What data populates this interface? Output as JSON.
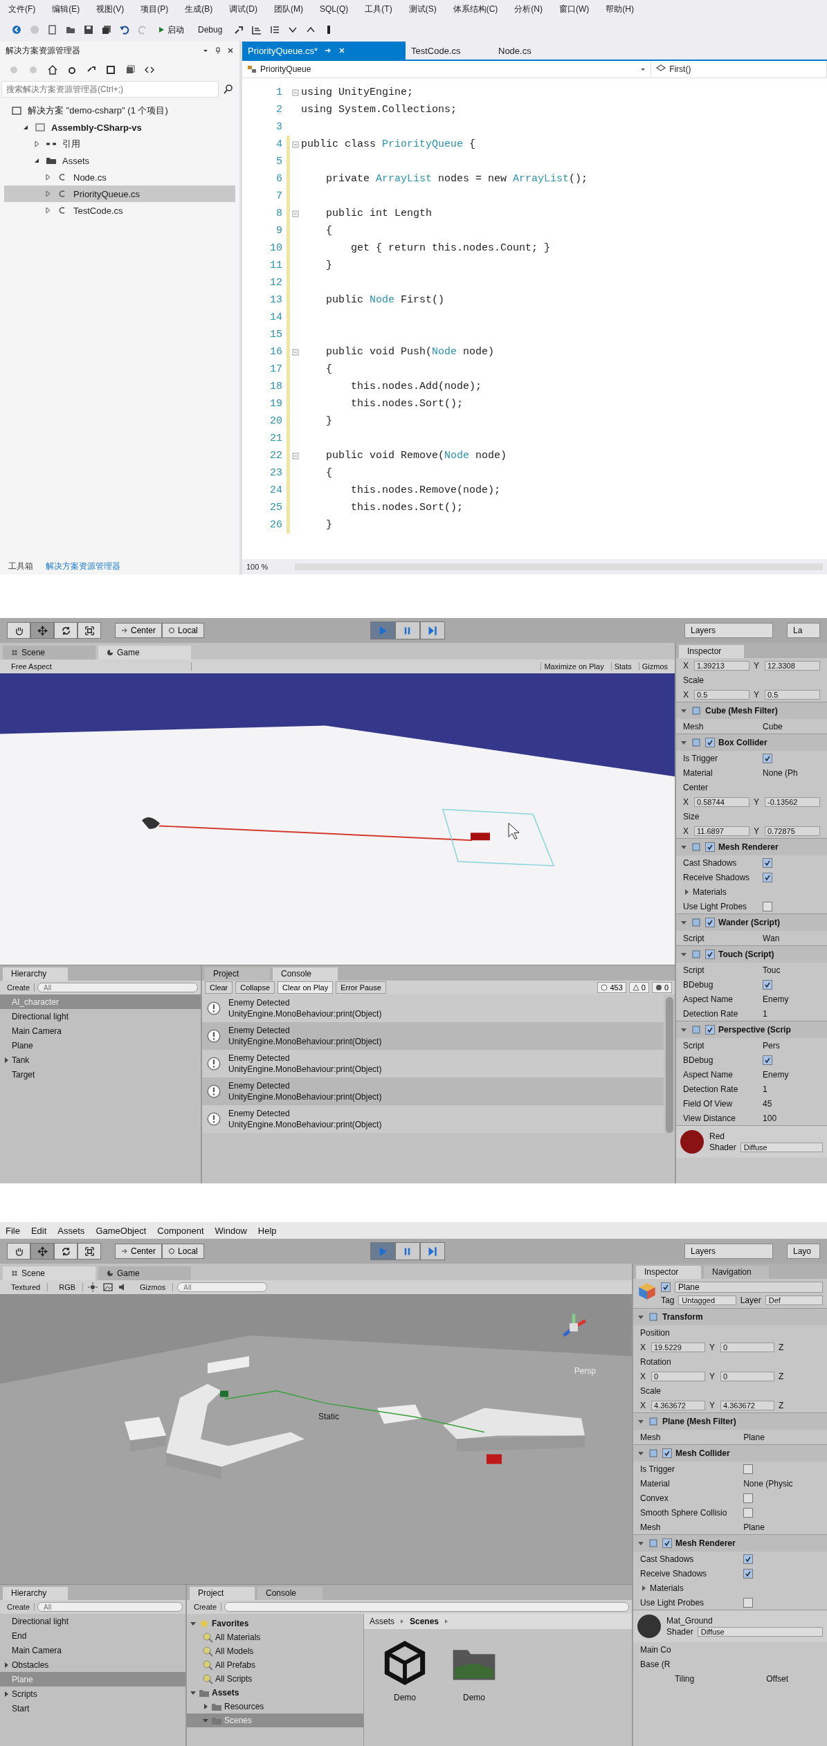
{
  "vs": {
    "menu": [
      "文件(F)",
      "编辑(E)",
      "视图(V)",
      "项目(P)",
      "生成(B)",
      "调试(D)",
      "团队(M)",
      "SQL(Q)",
      "工具(T)",
      "测试(S)",
      "体系结构(C)",
      "分析(N)",
      "窗口(W)",
      "帮助(H)"
    ],
    "toolbar": {
      "start": "启动",
      "configuration": "Debug"
    },
    "explorer": {
      "title": "解决方案资源管理器",
      "search_placeholder": "搜索解决方案资源管理器(Ctrl+;)",
      "tree": [
        {
          "label": "解决方案 \"demo-csharp\" (1 个项目)",
          "kind": "solution",
          "selected": false,
          "children": [
            {
              "label": "Assembly-CSharp-vs",
              "kind": "project",
              "expanded": true,
              "selected": false,
              "children": [
                {
                  "label": "引用",
                  "kind": "references",
                  "expanded": false,
                  "selected": false
                },
                {
                  "label": "Assets",
                  "kind": "folder",
                  "expanded": true,
                  "selected": false,
                  "children": [
                    {
                      "label": "Node.cs",
                      "kind": "file",
                      "expanded": false,
                      "selected": false
                    },
                    {
                      "label": "PriorityQueue.cs",
                      "kind": "file",
                      "expanded": false,
                      "selected": true
                    },
                    {
                      "label": "TestCode.cs",
                      "kind": "file",
                      "expanded": false,
                      "selected": false
                    }
                  ]
                }
              ]
            }
          ]
        }
      ],
      "bottom_tabs": [
        {
          "label": "工具箱",
          "selected": false
        },
        {
          "label": "解决方案资源管理器",
          "selected": true
        }
      ]
    },
    "editor": {
      "tabs": [
        {
          "label": "PriorityQueue.cs*",
          "selected": true
        },
        {
          "label": "TestCode.cs",
          "selected": false
        },
        {
          "label": "Node.cs",
          "selected": false
        }
      ],
      "class_nav": "PriorityQueue",
      "member_nav": "First()",
      "zoom": "100 %",
      "lines": [
        {
          "number": "1",
          "fold": true,
          "changed": false,
          "segments": [
            {
              "text": "using UnityEngine;",
              "kind": "code"
            }
          ]
        },
        {
          "number": "2",
          "fold": false,
          "changed": false,
          "segments": [
            {
              "text": "using System.Collections;",
              "kind": "code"
            }
          ]
        },
        {
          "number": "3",
          "fold": false,
          "changed": false
        },
        {
          "number": "4",
          "fold": true,
          "changed": true,
          "segments": [
            {
              "text": "public class ",
              "kind": "code"
            },
            {
              "text": "PriorityQueue",
              "kind": "type"
            },
            {
              "text": " {",
              "kind": "code"
            }
          ]
        },
        {
          "number": "5",
          "fold": false,
          "changed": true
        },
        {
          "number": "6",
          "fold": false,
          "changed": true,
          "segments": [
            {
              "text": "    private ",
              "kind": "code"
            },
            {
              "text": "ArrayList",
              "kind": "type"
            },
            {
              "text": " nodes = new ",
              "kind": "code"
            },
            {
              "text": "ArrayList",
              "kind": "type"
            },
            {
              "text": "();",
              "kind": "code"
            }
          ]
        },
        {
          "number": "7",
          "fold": false,
          "changed": true
        },
        {
          "number": "8",
          "fold": true,
          "changed": true,
          "segments": [
            {
              "text": "    public int Length",
              "kind": "code"
            }
          ]
        },
        {
          "number": "9",
          "fold": false,
          "changed": true,
          "segments": [
            {
              "text": "    {",
              "kind": "code"
            }
          ]
        },
        {
          "number": "10",
          "fold": false,
          "changed": true,
          "segments": [
            {
              "text": "        get { return this.nodes.Count; }",
              "kind": "code"
            }
          ]
        },
        {
          "number": "11",
          "fold": false,
          "changed": true,
          "segments": [
            {
              "text": "    }",
              "kind": "code"
            }
          ]
        },
        {
          "number": "12",
          "fold": false,
          "changed": true
        },
        {
          "number": "13",
          "fold": false,
          "changed": true,
          "segments": [
            {
              "text": "    public ",
              "kind": "code"
            },
            {
              "text": "Node",
              "kind": "type"
            },
            {
              "text": " First()",
              "kind": "code"
            }
          ]
        },
        {
          "number": "14",
          "fold": false,
          "changed": true
        },
        {
          "number": "15",
          "fold": false,
          "changed": true
        },
        {
          "number": "16",
          "fold": true,
          "changed": true,
          "segments": [
            {
              "text": "    public void Push(",
              "kind": "code"
            },
            {
              "text": "Node",
              "kind": "type"
            },
            {
              "text": " node)",
              "kind": "code"
            }
          ]
        },
        {
          "number": "17",
          "fold": false,
          "changed": true,
          "segments": [
            {
              "text": "    {",
              "kind": "code"
            }
          ]
        },
        {
          "number": "18",
          "fold": false,
          "changed": true,
          "segments": [
            {
              "text": "        this.nodes.Add(node);",
              "kind": "code"
            }
          ]
        },
        {
          "number": "19",
          "fold": false,
          "changed": true,
          "segments": [
            {
              "text": "        this.nodes.Sort();",
              "kind": "code"
            }
          ]
        },
        {
          "number": "20",
          "fold": false,
          "changed": true,
          "segments": [
            {
              "text": "    }",
              "kind": "code"
            }
          ]
        },
        {
          "number": "21",
          "fold": false,
          "changed": true
        },
        {
          "number": "22",
          "fold": true,
          "changed": true,
          "segments": [
            {
              "text": "    public void Remove(",
              "kind": "code"
            },
            {
              "text": "Node",
              "kind": "type"
            },
            {
              "text": " node)",
              "kind": "code"
            }
          ]
        },
        {
          "number": "23",
          "fold": false,
          "changed": true,
          "segments": [
            {
              "text": "    {",
              "kind": "code"
            }
          ]
        },
        {
          "number": "24",
          "fold": false,
          "changed": true,
          "segments": [
            {
              "text": "        this.nodes.Remove(node);",
              "kind": "code"
            }
          ]
        },
        {
          "number": "25",
          "fold": false,
          "changed": true,
          "segments": [
            {
              "text": "        this.nodes.Sort();",
              "kind": "code"
            }
          ]
        },
        {
          "number": "26",
          "fold": false,
          "changed": true,
          "segments": [
            {
              "text": "    }",
              "kind": "code"
            }
          ]
        }
      ]
    }
  },
  "game_editor": {
    "toolbar": {
      "tools": [
        {
          "selected": false
        },
        {
          "selected": true
        },
        {
          "selected": false
        },
        {
          "selected": false
        }
      ],
      "pivot": "Center",
      "space": "Local",
      "play_controls": [
        {
          "on": true
        },
        {
          "on": false
        },
        {
          "on": false
        }
      ],
      "layers": "Layers",
      "layout": "La"
    },
    "view_tabs": [
      {
        "label": "Scene",
        "selected": false
      },
      {
        "label": "Game",
        "selected": true
      }
    ],
    "view_bar": {
      "aspect": "Free Aspect",
      "buttons": [
        "Maximize on Play",
        "Stats",
        "Gizmos"
      ]
    },
    "inspector": {
      "tabs": [
        {
          "label": "Inspector",
          "selected": true
        }
      ],
      "items": [
        {
          "kind": "vector",
          "fields": [
            {
              "axis": "X",
              "value": "1.39213"
            },
            {
              "axis": "Y",
              "value": "12.3308"
            }
          ]
        },
        {
          "kind": "caption",
          "label": "Scale"
        },
        {
          "kind": "vector",
          "fields": [
            {
              "axis": "X",
              "value": "0.5"
            },
            {
              "axis": "Y",
              "value": "0.5"
            }
          ]
        },
        {
          "kind": "header",
          "title": "Cube (Mesh Filter)",
          "expanded": true
        },
        {
          "kind": "value",
          "label": "Mesh",
          "value": "Cube"
        },
        {
          "kind": "header",
          "title": "Box Collider",
          "expanded": true,
          "enabled": true
        },
        {
          "kind": "check",
          "label": "Is Trigger",
          "checked": true
        },
        {
          "kind": "value",
          "label": "Material",
          "value": "None (Ph"
        },
        {
          "kind": "caption",
          "label": "Center"
        },
        {
          "kind": "vector",
          "fields": [
            {
              "axis": "X",
              "value": "0.58744"
            },
            {
              "axis": "Y",
              "value": "-0.13562"
            }
          ]
        },
        {
          "kind": "caption",
          "label": "Size"
        },
        {
          "kind": "vector",
          "fields": [
            {
              "axis": "X",
              "value": "11.6897"
            },
            {
              "axis": "Y",
              "value": "0.72875"
            }
          ]
        },
        {
          "kind": "header",
          "title": "Mesh Renderer",
          "expanded": true,
          "enabled": true
        },
        {
          "kind": "check",
          "label": "Cast Shadows",
          "checked": true
        },
        {
          "kind": "check",
          "label": "Receive Shadows",
          "checked": true
        },
        {
          "kind": "foldout",
          "label": "Materials",
          "expanded": false
        },
        {
          "kind": "check",
          "label": "Use Light Probes",
          "checked": false
        },
        {
          "kind": "header",
          "title": "Wander (Script)",
          "expanded": true,
          "enabled": true
        },
        {
          "kind": "value",
          "label": "Script",
          "value": "Wan"
        },
        {
          "kind": "header",
          "title": "Touch (Script)",
          "expanded": true,
          "enabled": true
        },
        {
          "kind": "value",
          "label": "Script",
          "value": "Touc"
        },
        {
          "kind": "check",
          "label": "BDebug",
          "checked": true
        },
        {
          "kind": "value",
          "label": "Aspect Name",
          "value": "Enemy"
        },
        {
          "kind": "value",
          "label": "Detection Rate",
          "value": "1"
        },
        {
          "kind": "header",
          "title": "Perspective (Scrip",
          "expanded": true,
          "enabled": true
        },
        {
          "kind": "value",
          "label": "Script",
          "value": "Pers"
        },
        {
          "kind": "check",
          "label": "BDebug",
          "checked": true
        },
        {
          "kind": "value",
          "label": "Aspect Name",
          "value": "Enemy"
        },
        {
          "kind": "value",
          "label": "Detection Rate",
          "value": "1"
        },
        {
          "kind": "value",
          "label": "Field Of View",
          "value": "45"
        },
        {
          "kind": "value",
          "label": "View Distance",
          "value": "100"
        },
        {
          "kind": "material",
          "name": "Red",
          "shader_label": "Shader",
          "shader": "Diffuse",
          "color": "#8a1212"
        }
      ]
    },
    "hierarchy": {
      "title": "Hierarchy",
      "create": "Create",
      "search_placeholder": "All",
      "items": [
        {
          "label": "AI_character",
          "selected": true
        },
        {
          "label": "Directional light",
          "selected": false
        },
        {
          "label": "Main Camera",
          "selected": false
        },
        {
          "label": "Plane",
          "selected": false
        },
        {
          "label": "Tank",
          "selected": false,
          "expanded": false
        },
        {
          "label": "Target",
          "selected": false
        }
      ]
    },
    "console": {
      "tabs": [
        {
          "label": "Project",
          "selected": false
        },
        {
          "label": "Console",
          "selected": true
        }
      ],
      "buttons": [
        {
          "label": "Clear",
          "on": false
        },
        {
          "label": "Collapse",
          "on": false
        },
        {
          "label": "Clear on Play",
          "on": true
        },
        {
          "label": "Error Pause",
          "on": false
        }
      ],
      "counts": {
        "logs": "453",
        "warnings": "0",
        "errors": "0"
      },
      "entries": [
        {
          "message": "Enemy Detected",
          "source": "UnityEngine.MonoBehaviour:print(Object)"
        },
        {
          "message": "Enemy Detected",
          "source": "UnityEngine.MonoBehaviour:print(Object)"
        },
        {
          "message": "Enemy Detected",
          "source": "UnityEngine.MonoBehaviour:print(Object)"
        },
        {
          "message": "Enemy Detected",
          "source": "UnityEngine.MonoBehaviour:print(Object)"
        },
        {
          "message": "Enemy Detected",
          "source": "UnityEngine.MonoBehaviour:print(Object)"
        }
      ]
    }
  },
  "scene_editor": {
    "menu": [
      "File",
      "Edit",
      "Assets",
      "GameObject",
      "Component",
      "Window",
      "Help"
    ],
    "toolbar": {
      "tools": [
        {
          "selected": false
        },
        {
          "selected": true
        },
        {
          "selected": false
        },
        {
          "selected": false
        }
      ],
      "pivot": "Center",
      "space": "Local",
      "play_controls": [
        {
          "on": true
        },
        {
          "on": false
        },
        {
          "on": false
        }
      ],
      "layers": "Layers",
      "layout": "Layo"
    },
    "view_tabs": [
      {
        "label": "Scene",
        "selected": true
      },
      {
        "label": "Game",
        "selected": false
      }
    ],
    "view_bar": {
      "shading": "Textured",
      "mode": "RGB",
      "gizmos": "Gizmos",
      "search_placeholder": "All"
    },
    "projection_label": "Persp",
    "object_label": "Static",
    "inspector": {
      "tabs": [
        {
          "label": "Inspector",
          "selected": true
        },
        {
          "label": "Navigation",
          "selected": false
        }
      ],
      "items": [
        {
          "kind": "object",
          "enabled": true,
          "name": "Plane",
          "tag_label": "Tag",
          "tag": "Untagged",
          "layer_label": "Layer",
          "layer": "Def"
        },
        {
          "kind": "header",
          "title": "Transform",
          "expanded": true
        },
        {
          "kind": "caption",
          "label": "Position"
        },
        {
          "kind": "vector",
          "fields": [
            {
              "axis": "X",
              "value": "19.5229"
            },
            {
              "axis": "Y",
              "value": "0"
            },
            {
              "axis": "Z"
            }
          ]
        },
        {
          "kind": "caption",
          "label": "Rotation"
        },
        {
          "kind": "vector",
          "fields": [
            {
              "axis": "X",
              "value": "0"
            },
            {
              "axis": "Y",
              "value": "0"
            },
            {
              "axis": "Z"
            }
          ]
        },
        {
          "kind": "caption",
          "label": "Scale"
        },
        {
          "kind": "vector",
          "fields": [
            {
              "axis": "X",
              "value": "4.363672"
            },
            {
              "axis": "Y",
              "value": "4.363672"
            },
            {
              "axis": "Z"
            }
          ]
        },
        {
          "kind": "header",
          "title": "Plane (Mesh Filter)",
          "expanded": true
        },
        {
          "kind": "value",
          "label": "Mesh",
          "value": "Plane"
        },
        {
          "kind": "header",
          "title": "Mesh Collider",
          "expanded": true,
          "enabled": true
        },
        {
          "kind": "check",
          "label": "Is Trigger",
          "checked": false
        },
        {
          "kind": "value",
          "label": "Material",
          "value": "None (Physic"
        },
        {
          "kind": "check",
          "label": "Convex",
          "checked": false
        },
        {
          "kind": "check",
          "label": "Smooth Sphere Collisio",
          "checked": false
        },
        {
          "kind": "value",
          "label": "Mesh",
          "value": "Plane"
        },
        {
          "kind": "header",
          "title": "Mesh Renderer",
          "expanded": true,
          "enabled": true
        },
        {
          "kind": "check",
          "label": "Cast Shadows",
          "checked": true
        },
        {
          "kind": "check",
          "label": "Receive Shadows",
          "checked": true
        },
        {
          "kind": "foldout",
          "label": "Materials",
          "expanded": false
        },
        {
          "kind": "check",
          "label": "Use Light Probes",
          "checked": false
        },
        {
          "kind": "material",
          "name": "Mat_Ground",
          "shader_label": "Shader",
          "shader": "Diffuse",
          "color": "#333333"
        },
        {
          "kind": "caption",
          "label": "Main Co"
        },
        {
          "kind": "caption",
          "label": "Base (R"
        },
        {
          "kind": "pair",
          "left": "Tiling",
          "right": "Offset"
        }
      ]
    },
    "hierarchy": {
      "title": "Hierarchy",
      "create": "Create",
      "search_placeholder": "All",
      "items": [
        {
          "label": "Directional light",
          "selected": false
        },
        {
          "label": "End",
          "selected": false
        },
        {
          "label": "Main Camera",
          "selected": false
        },
        {
          "label": "Obstacles",
          "selected": false,
          "expanded": false
        },
        {
          "label": "Plane",
          "selected": true
        },
        {
          "label": "Scripts",
          "selected": false,
          "expanded": false
        },
        {
          "label": "Start",
          "selected": false
        }
      ]
    },
    "project": {
      "tabs": [
        {
          "label": "Project",
          "selected": true
        },
        {
          "label": "Console",
          "selected": false
        }
      ],
      "create": "Create",
      "tree": [
        {
          "label": "Favorites",
          "kind": "favorites",
          "expanded": true,
          "selected": false,
          "children": [
            {
              "label": "All Materials",
              "kind": "search",
              "selected": false
            },
            {
              "label": "All Models",
              "kind": "search",
              "selected": false
            },
            {
              "label": "All Prefabs",
              "kind": "search",
              "selected": false
            },
            {
              "label": "All Scripts",
              "kind": "search",
              "selected": false
            }
          ]
        },
        {
          "label": "Assets",
          "kind": "folder",
          "expanded": true,
          "selected": false,
          "children": [
            {
              "label": "Resources",
              "kind": "folder",
              "expanded": false,
              "selected": false
            },
            {
              "label": "Scenes",
              "kind": "folder",
              "expanded": true,
              "selected": true
            }
          ]
        }
      ],
      "breadcrumb": [
        "Assets",
        "Scenes"
      ],
      "assets": [
        {
          "label": "Demo",
          "kind": "scene"
        },
        {
          "label": "Demo",
          "kind": "folder"
        }
      ]
    }
  }
}
